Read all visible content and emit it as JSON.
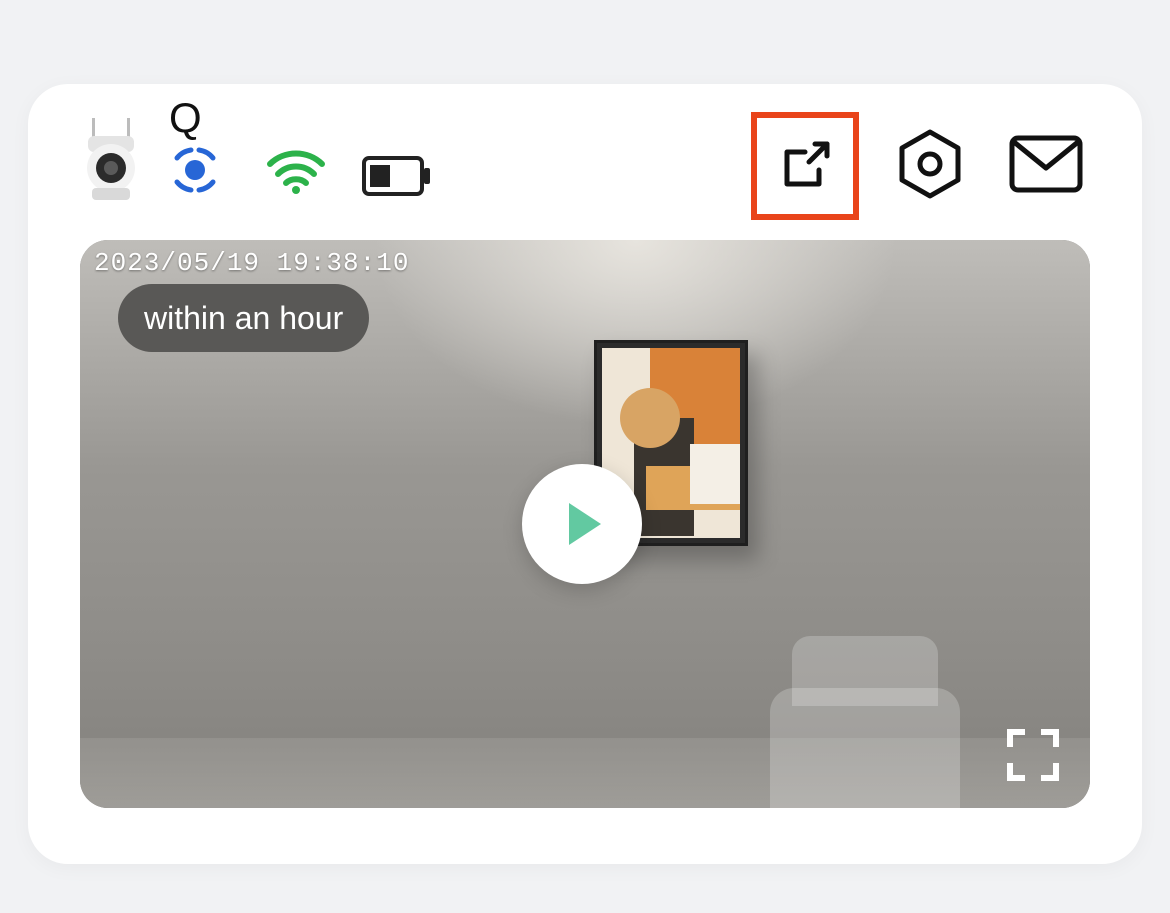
{
  "device": {
    "name": "Q"
  },
  "status": {
    "motion_detection": "on",
    "wifi_signal": "strong",
    "wifi_color": "#2cb24a",
    "battery_level_pct": 40
  },
  "actions": {
    "share": "share",
    "settings": "settings",
    "messages": "messages"
  },
  "highlight": {
    "target": "share-button",
    "color": "#e9441a"
  },
  "video": {
    "timestamp": "2023/05/19 19:38:10",
    "last_activity_label": "within an hour",
    "state": "paused",
    "play": "play",
    "fullscreen": "fullscreen"
  }
}
